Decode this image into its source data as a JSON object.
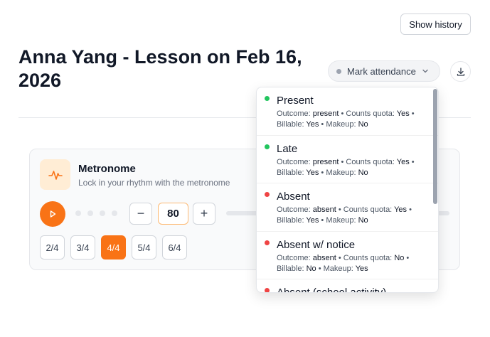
{
  "header": {
    "history_label": "Show history",
    "title": "Anna Yang - Lesson on Feb 16, 2026",
    "attendance_label": "Mark attendance"
  },
  "metronome": {
    "title": "Metronome",
    "subtitle": "Lock in your rhythm with the metronome",
    "bpm": "80",
    "decrement": "−",
    "increment": "+",
    "time_signatures": [
      "2/4",
      "3/4",
      "4/4",
      "5/4",
      "6/4"
    ],
    "active_time_signature": "4/4",
    "beat_count": 4
  },
  "attendance_options": [
    {
      "label": "Present",
      "status_color": "#22c55e",
      "outcome_label": "Outcome:",
      "outcome": "present",
      "quota_label": "Counts quota:",
      "quota": "Yes",
      "billable_label": "Billable:",
      "billable": "Yes",
      "makeup_label": "Makeup:",
      "makeup": "No"
    },
    {
      "label": "Late",
      "status_color": "#22c55e",
      "outcome_label": "Outcome:",
      "outcome": "present",
      "quota_label": "Counts quota:",
      "quota": "Yes",
      "billable_label": "Billable:",
      "billable": "Yes",
      "makeup_label": "Makeup:",
      "makeup": "No"
    },
    {
      "label": "Absent",
      "status_color": "#ef4444",
      "outcome_label": "Outcome:",
      "outcome": "absent",
      "quota_label": "Counts quota:",
      "quota": "Yes",
      "billable_label": "Billable:",
      "billable": "Yes",
      "makeup_label": "Makeup:",
      "makeup": "No"
    },
    {
      "label": "Absent w/ notice",
      "status_color": "#ef4444",
      "outcome_label": "Outcome:",
      "outcome": "absent",
      "quota_label": "Counts quota:",
      "quota": "No",
      "billable_label": "Billable:",
      "billable": "No",
      "makeup_label": "Makeup:",
      "makeup": "Yes"
    },
    {
      "label": "Absent (school activity)",
      "status_color": "#ef4444"
    }
  ],
  "colors": {
    "accent": "#f97316",
    "present": "#22c55e",
    "absent": "#ef4444"
  },
  "icons": {
    "download": "download-icon",
    "metronome": "waveform-icon",
    "play": "play-icon",
    "chevron": "chevron-down-icon"
  }
}
